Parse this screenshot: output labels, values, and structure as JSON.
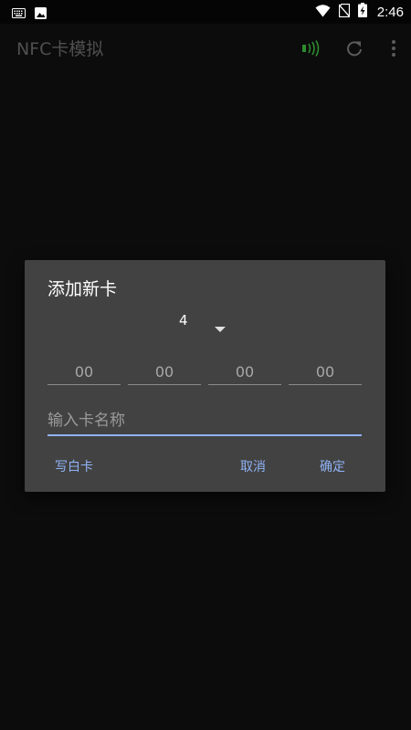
{
  "status_bar": {
    "time": "2:46",
    "icons": [
      "keyboard-icon",
      "image-icon",
      "wifi-icon",
      "no-sim-icon",
      "battery-charging-icon"
    ]
  },
  "app_bar": {
    "title": "NFC卡模拟",
    "actions": [
      "nfc-signal-icon",
      "refresh-icon",
      "more-vert-icon"
    ],
    "nfc_icon_color": "#2e8b2e"
  },
  "dialog": {
    "title": "添加新卡",
    "length_spinner": {
      "selected": "4"
    },
    "hex_fields": [
      {
        "placeholder": "00",
        "value": ""
      },
      {
        "placeholder": "00",
        "value": ""
      },
      {
        "placeholder": "00",
        "value": ""
      },
      {
        "placeholder": "00",
        "value": ""
      }
    ],
    "name_input": {
      "placeholder": "输入卡名称",
      "value": ""
    },
    "buttons": {
      "write_blank": "写白卡",
      "cancel": "取消",
      "confirm": "确定"
    },
    "accent_color": "#8fb2f5",
    "background_color": "#424242"
  }
}
